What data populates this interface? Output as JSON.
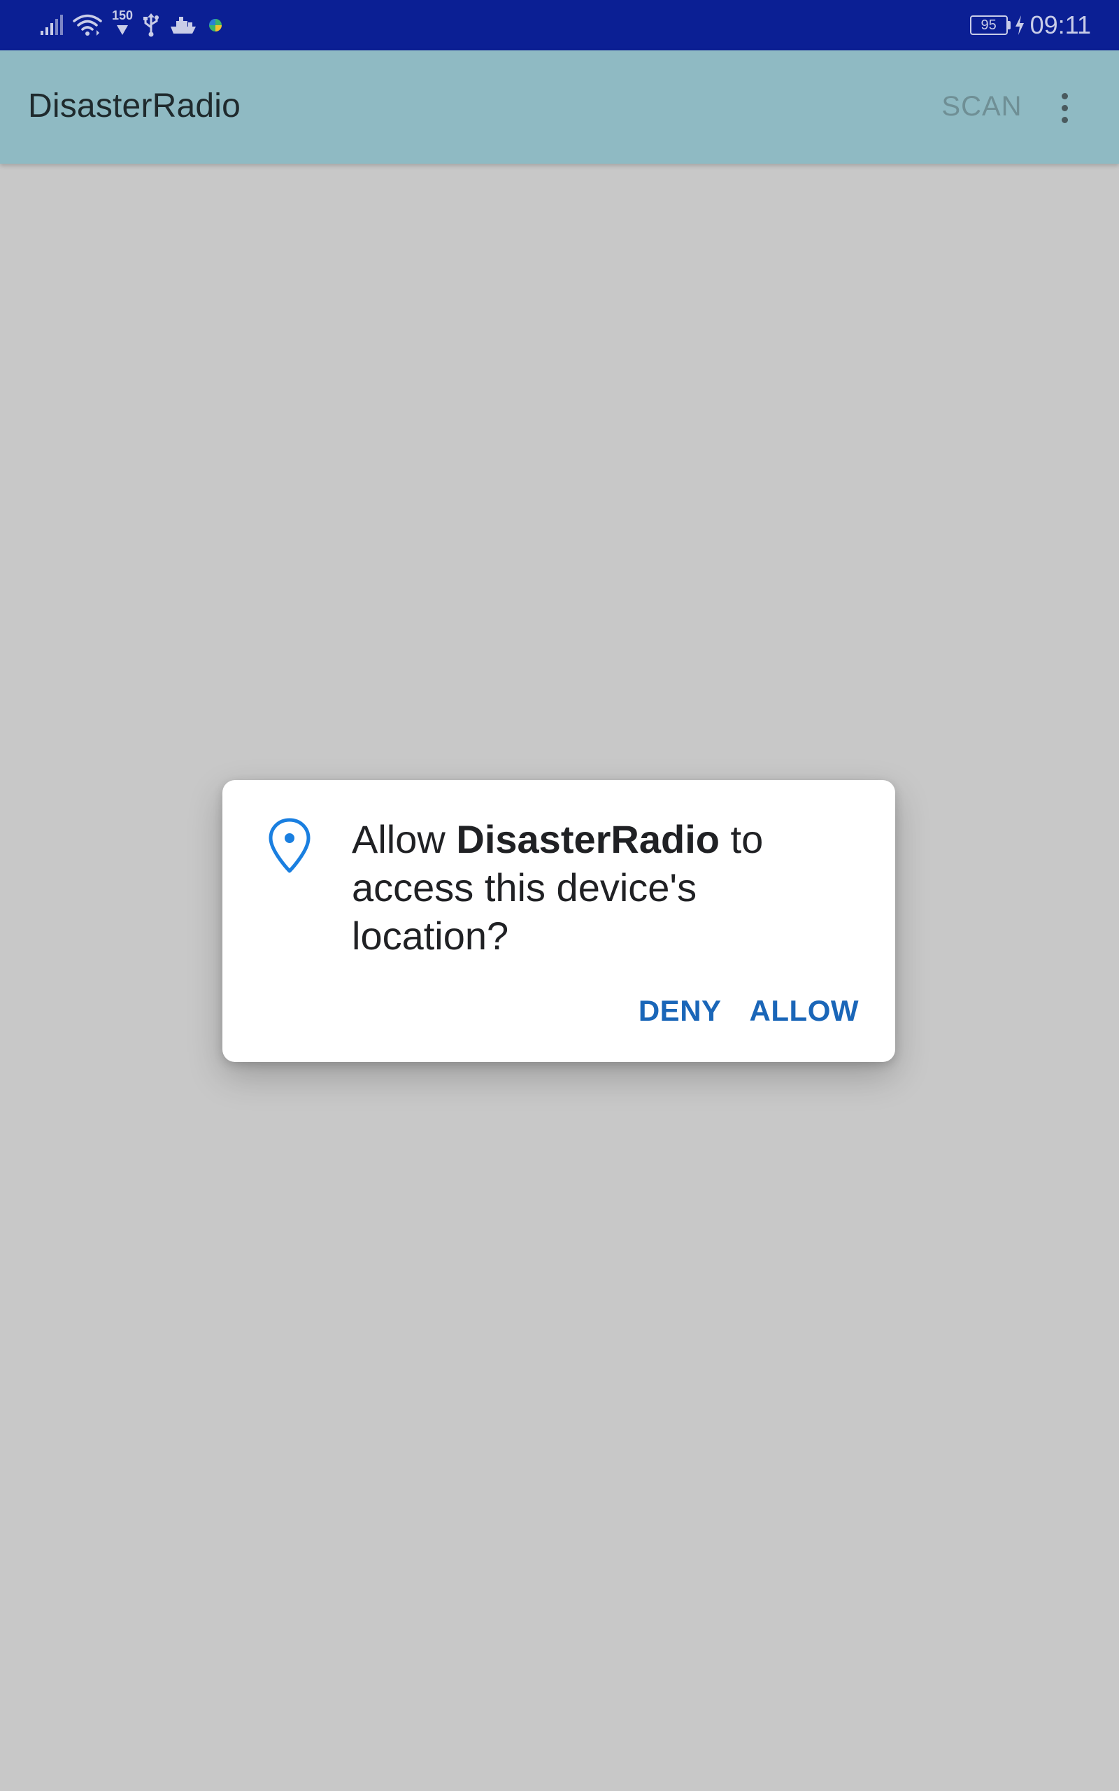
{
  "status_bar": {
    "network_speed": "150",
    "battery_level": "95",
    "time": "09:11",
    "icons": [
      "signal-icon",
      "wifi-icon",
      "download-icon",
      "usb-icon",
      "ship-icon",
      "app-notification-icon",
      "charging-icon"
    ],
    "background_color": "#0b1f94"
  },
  "app_bar": {
    "title": "DisasterRadio",
    "scan_label": "SCAN",
    "menu_icon": "more-vert-icon",
    "background_color": "#8fbac3"
  },
  "permission_dialog": {
    "icon": "location-pin-icon",
    "message_prefix": "Allow ",
    "app_name": "DisasterRadio",
    "message_suffix": " to access this device's location?",
    "deny_label": "DENY",
    "allow_label": "ALLOW",
    "accent_color": "#1a66b8"
  }
}
